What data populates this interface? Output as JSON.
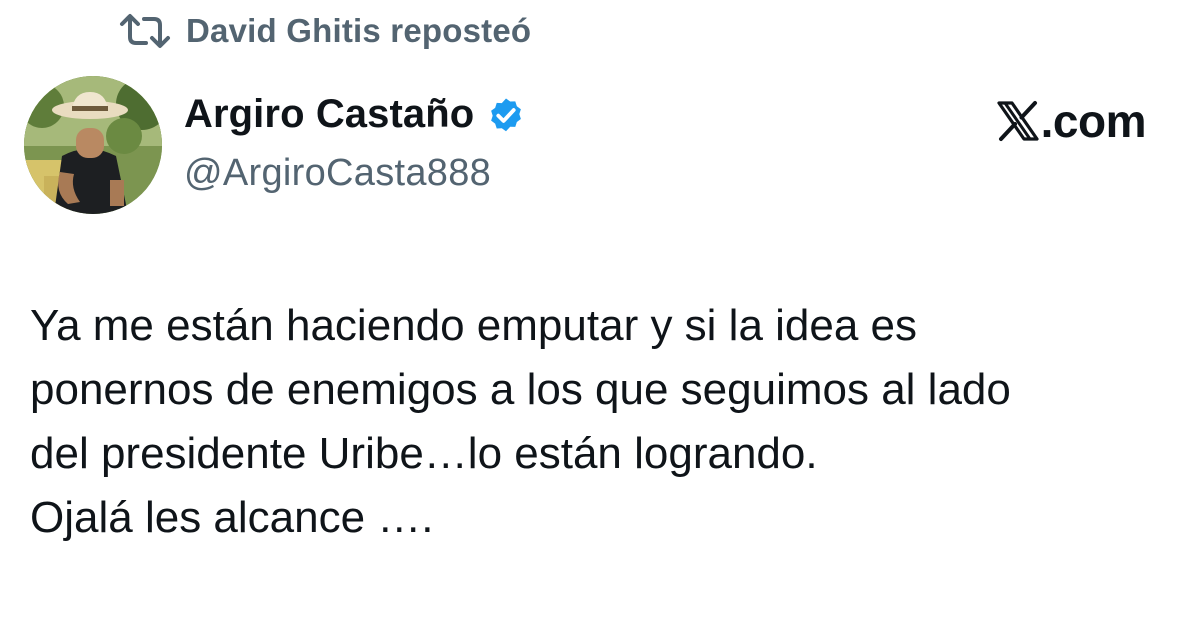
{
  "repost": {
    "icon": "repost-icon",
    "label": "David Ghitis reposteó"
  },
  "author": {
    "avatar": "profile-photo",
    "display_name": "Argiro Castaño",
    "verified_icon": "verified-badge-icon",
    "verified_color": "#1d9bf0",
    "handle": "@ArgiroCasta888"
  },
  "branding": {
    "logo_icon": "x-logo-icon",
    "site_text": ".com"
  },
  "tweet": {
    "lines": [
      "Ya me están haciendo emputar y si la idea es",
      "ponernos de enemigos a los que seguimos al lado",
      "del presidente Uribe…lo están logrando.",
      "Ojalá les alcance …."
    ]
  },
  "colors": {
    "primary_text": "#0f1419",
    "secondary_text": "#536471",
    "background": "#ffffff"
  }
}
